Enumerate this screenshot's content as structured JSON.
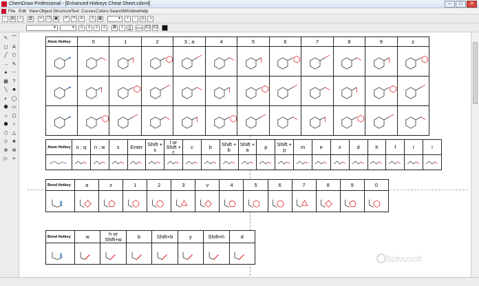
{
  "window": {
    "title": "ChemDraw Professional - [Enhanced Hotkeys Cheat Sheet.cdxml]",
    "controls": [
      "–",
      "□",
      "✕"
    ]
  },
  "menu": [
    "File",
    "Edit",
    "View",
    "Object",
    "Structure",
    "Text",
    "Curves",
    "Colors",
    "Search",
    "Window",
    "Help"
  ],
  "toolbar": {
    "zoom_value": "",
    "font_value": "",
    "size_value": "",
    "style_labels": [
      "B",
      "I",
      "U",
      "CH2",
      "X2",
      "X2"
    ],
    "icons": [
      "new-icon",
      "open-icon",
      "save-icon",
      "print-icon",
      "cut-icon",
      "copy-icon",
      "paste-icon",
      "undo-icon",
      "redo-icon",
      "zoom-in-icon",
      "zoom-out-icon"
    ]
  },
  "palette": {
    "icons": [
      "select-icon",
      "lasso-icon",
      "eraser-icon",
      "text-icon",
      "bond-icon",
      "ring-icon",
      "arrow-icon",
      "pen-icon",
      "atom-icon",
      "chain-icon",
      "template-icon",
      "query-icon"
    ]
  },
  "tables": {
    "atom": {
      "row_header": "Atom Hotkey",
      "columns": [
        "0",
        "1",
        "2",
        "3 ; a",
        "4",
        "5",
        "6",
        "7",
        "8",
        "9",
        "z"
      ]
    },
    "atom2": {
      "row_header": "Atom Hotkey",
      "columns": [
        "o ; q",
        "n ; w",
        "s",
        "Enter",
        "Shift + s",
        "l or\nShift + c",
        "c",
        "b",
        "Shift + b",
        "Shift + a",
        "p",
        "Shift + p",
        "m",
        "e",
        "x",
        "d",
        "h",
        "f",
        "r",
        "i"
      ]
    },
    "bond": {
      "row_header": "Bond Hotkey",
      "columns": [
        "a",
        "z",
        "1",
        "2",
        "3",
        "v",
        "4",
        "5",
        "6",
        "7",
        "8",
        "9",
        "0"
      ]
    },
    "bond2": {
      "row_header": "Bond Hotkey",
      "columns": [
        "w",
        "h or Shift+w",
        "b",
        "Shift+b",
        "y",
        "Shift+h",
        "d"
      ]
    }
  },
  "watermark": "Solvusoft",
  "colors": {
    "structure": "#333333",
    "highlight": "#e0262a",
    "blue_bond": "#3a78c8",
    "accent": "#c8102e"
  }
}
